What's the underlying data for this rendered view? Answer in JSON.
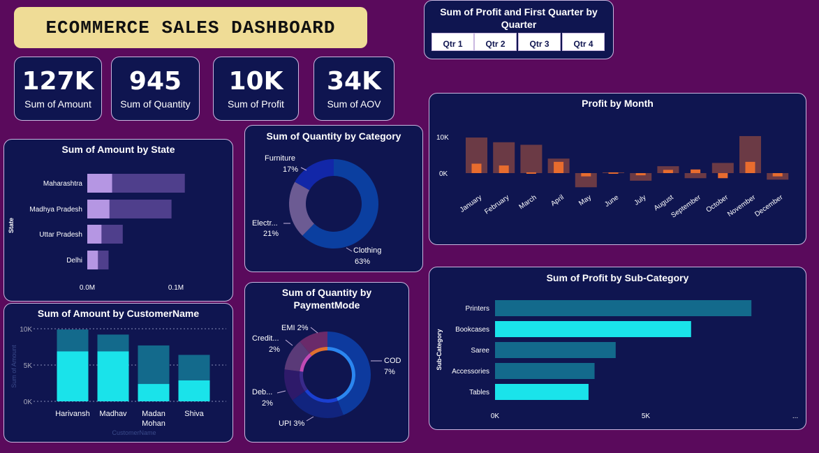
{
  "dashboard_title": "ECOMMERCE SALES DASHBOARD",
  "kpis": [
    {
      "value": "127K",
      "label": "Sum of Amount"
    },
    {
      "value": "945",
      "label": "Sum of Quantity"
    },
    {
      "value": "10K",
      "label": "Sum of Profit"
    },
    {
      "value": "34K",
      "label": "Sum of AOV"
    }
  ],
  "slicer": {
    "title": "Sum of Profit and First Quarter by Quarter",
    "options": [
      "Qtr 1",
      "Qtr 2",
      "Qtr 3",
      "Qtr 4"
    ]
  },
  "colors": {
    "background": "#5a0a5c",
    "card": "#0f1550",
    "banner": "#efdc96",
    "cyan": "#1ae3ea",
    "teal": "#136a8c",
    "lavender": "#b596e3",
    "lavender_dark": "#4f3f8c",
    "profit_bar": "#6b3a45",
    "profit_inner": "#e86c2e"
  },
  "chart_data": [
    {
      "id": "amount_by_state",
      "type": "bar",
      "orientation": "horizontal",
      "title": "Sum of Amount by State",
      "ylabel": "State",
      "categories": [
        "Maharashtra",
        "Madhya Pradesh",
        "Uttar Pradesh",
        "Delhi"
      ],
      "series": [
        {
          "values": [
            110000,
            95000,
            40000,
            24000
          ]
        },
        {
          "values": [
            28000,
            25000,
            16000,
            12000
          ]
        }
      ],
      "xticks": [
        "0.0M",
        "0.1M"
      ],
      "xlim": [
        0,
        0.11
      ]
    },
    {
      "id": "quantity_by_category",
      "type": "pie",
      "title": "Sum of Quantity by Category",
      "slices": [
        {
          "label": "Clothing",
          "pct": "63%",
          "value": 63,
          "color": "#0b3fa0"
        },
        {
          "label": "Electr...",
          "pct": "21%",
          "value": 21,
          "color": "#6c5b93"
        },
        {
          "label": "Furniture",
          "pct": "17%",
          "value": 17,
          "color": "#1227a8"
        }
      ]
    },
    {
      "id": "quantity_by_paymentmode",
      "type": "pie",
      "title": "Sum of Quantity by PaymentMode",
      "slices": [
        {
          "label": "COD",
          "pct": "7%",
          "value": 44,
          "color": "#0d3a9e"
        },
        {
          "label": "UPI 3%",
          "pct": "",
          "value": 21,
          "color": "#11247e"
        },
        {
          "label": "Deb...",
          "pct": "2%",
          "value": 12,
          "color": "#2e1a6a"
        },
        {
          "label": "Credit...",
          "pct": "2%",
          "value": 12,
          "color": "#5a3a78"
        },
        {
          "label": "EMI 2%",
          "pct": "",
          "value": 11,
          "color": "#6a2a6a"
        }
      ]
    },
    {
      "id": "profit_by_month",
      "type": "bar",
      "title": "Profit by Month",
      "categories": [
        "January",
        "February",
        "March",
        "April",
        "May",
        "June",
        "July",
        "August",
        "September",
        "October",
        "November",
        "December"
      ],
      "series": [
        {
          "values": [
            9800,
            8500,
            7800,
            4000,
            -3900,
            200,
            -2100,
            1900,
            -1400,
            2800,
            10200,
            -1800
          ]
        },
        {
          "values": [
            2600,
            2100,
            200,
            3100,
            -900,
            200,
            -600,
            900,
            1000,
            -1400,
            3100,
            -900
          ]
        }
      ],
      "yticks": [
        "10K",
        "0K"
      ],
      "ylim": [
        -5000,
        11000
      ]
    },
    {
      "id": "amount_by_customer",
      "type": "bar",
      "title": "Sum of Amount by CustomerName",
      "xlabel": "CustomerName",
      "ylabel": "Sum of Amount",
      "categories": [
        "Harivansh",
        "Madhav",
        "Madan Mohan",
        "Shiva"
      ],
      "series": [
        {
          "values": [
            6900,
            6900,
            2400,
            2900
          ]
        },
        {
          "values": [
            3000,
            2300,
            5300,
            3500
          ]
        }
      ],
      "yticks": [
        "10K",
        "5K",
        "0K"
      ],
      "ylim": [
        0,
        10000
      ]
    },
    {
      "id": "profit_by_subcategory",
      "type": "bar",
      "orientation": "horizontal",
      "title": "Sum of Profit by Sub-Category",
      "ylabel": "Sub-Category",
      "categories": [
        "Printers",
        "Bookcases",
        "Saree",
        "Accessories",
        "Tables"
      ],
      "values": [
        8500,
        6500,
        4000,
        3300,
        3100
      ],
      "highlight": [
        false,
        true,
        false,
        false,
        true
      ],
      "xticks": [
        "0K",
        "5K",
        "..."
      ],
      "xlim": [
        0,
        9000
      ]
    }
  ]
}
